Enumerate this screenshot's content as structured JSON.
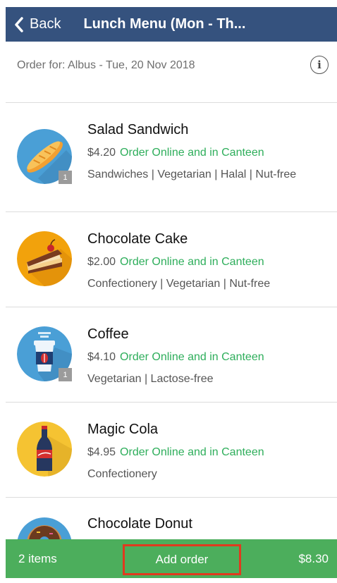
{
  "navbar": {
    "back_label": "Back",
    "title": "Lunch Menu (Mon - Th..."
  },
  "order_for": {
    "text": "Order for: Albus - Tue, 20 Nov 2018",
    "info_icon": "info-icon"
  },
  "items": [
    {
      "name": "Salad Sandwich",
      "price": "$4.20",
      "availability": "Order Online and in Canteen",
      "tags": "Sandwiches | Vegetarian | Halal | Nut-free",
      "qty_badge": "1",
      "icon": "bread-icon",
      "color": "#4a9fd6"
    },
    {
      "name": "Chocolate Cake",
      "price": "$2.00",
      "availability": "Order Online and in Canteen",
      "tags": "Confectionery | Vegetarian | Nut-free",
      "qty_badge": "",
      "icon": "cake-icon",
      "color": "#f2a20c"
    },
    {
      "name": "Coffee",
      "price": "$4.10",
      "availability": "Order Online and in Canteen",
      "tags": "Vegetarian | Lactose-free",
      "qty_badge": "1",
      "icon": "coffee-cup-icon",
      "color": "#4a9fd6"
    },
    {
      "name": "Magic Cola",
      "price": "$4.95",
      "availability": "Order Online and in Canteen",
      "tags": "Confectionery",
      "qty_badge": "",
      "icon": "cola-bottle-icon",
      "color": "#f5c332"
    },
    {
      "name": "Chocolate Donut",
      "price": "",
      "availability": "",
      "tags": "",
      "qty_badge": "",
      "icon": "donut-icon",
      "color": "#4a9fd6"
    }
  ],
  "bottom_bar": {
    "count": "2 items",
    "add_order_label": "Add order",
    "total": "$8.30"
  },
  "colors": {
    "navbar": "#35527e",
    "accent_green": "#2eae5b",
    "bottom_bar": "#4cae5c",
    "highlight_border": "#e03a1e"
  }
}
